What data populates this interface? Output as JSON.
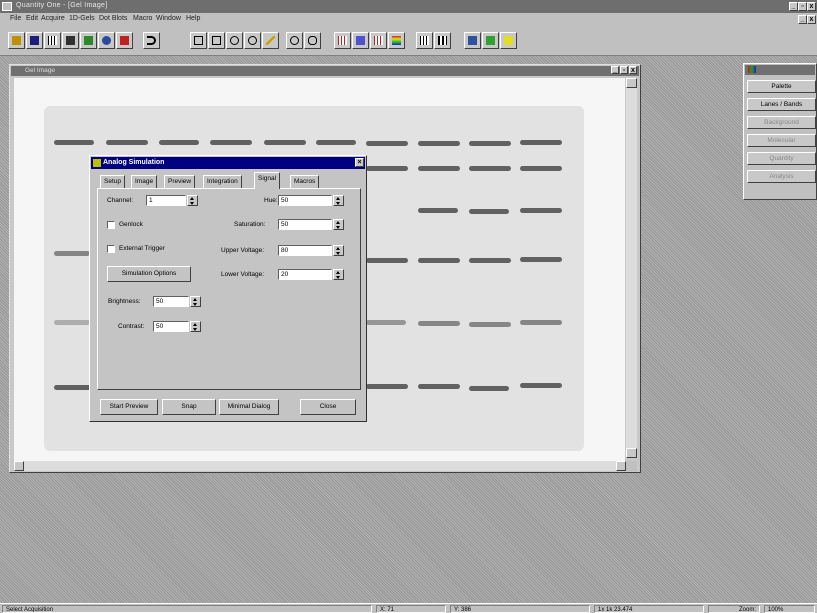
{
  "app": {
    "title": "Quantity One - [Gel Image]"
  },
  "menu": [
    "File",
    "Edit",
    "Acquire",
    "1D-Gels",
    "Dot Blots",
    "Macro",
    "Window",
    "Help"
  ],
  "toolbar": {
    "icons": [
      "open-icon",
      "save-icon",
      "grid-icon",
      "camera-icon",
      "checkmark-icon",
      "color-picker-icon",
      "book-icon",
      "undo-icon",
      "crop-icon",
      "rectangle-icon",
      "ellipse-icon",
      "circle-icon",
      "pencil-icon",
      "zoom-icon",
      "hand-icon",
      "lanes-icon",
      "bands-icon",
      "measure-icon",
      "colorbar-icon",
      "stats-icon",
      "report-icon",
      "export-icon",
      "send-icon",
      "note-icon"
    ]
  },
  "image_window": {
    "title": "Gel Image"
  },
  "dialog": {
    "title": "Analog Simulation",
    "close": "×",
    "tabs": [
      "Setup",
      "Image",
      "Preview",
      "Integration",
      "Signal",
      "Macros"
    ],
    "active_tab": "Signal",
    "channel_label": "Channel:",
    "channel_value": "1",
    "genlock_label": "Genlock",
    "external_trigger_label": "External Trigger",
    "simulation_options_label": "Simulation Options",
    "brightness_label": "Brightness:",
    "brightness_value": "50",
    "contrast_label": "Contrast:",
    "contrast_value": "50",
    "hue_label": "Hue:",
    "hue_value": "50",
    "saturation_label": "Saturation:",
    "saturation_value": "50",
    "upper_voltage_label": "Upper Voltage:",
    "upper_voltage_value": "80",
    "lower_voltage_label": "Lower Voltage:",
    "lower_voltage_value": "20",
    "start_preview_label": "Start Preview",
    "snap_label": "Snap",
    "minimal_dialog_label": "Minimal Dialog",
    "close_label": "Close"
  },
  "palette": {
    "items": [
      "Palette",
      "Lanes / Bands",
      "Background",
      "Molecular",
      "Quantity",
      "Analysis"
    ]
  },
  "status": {
    "left": "Select Acquisition",
    "coords": "X: 71",
    "y": "Y: 386",
    "size": "1x 1k  23.474",
    "zoom": "Zoom:",
    "zoom_value": "100%"
  }
}
